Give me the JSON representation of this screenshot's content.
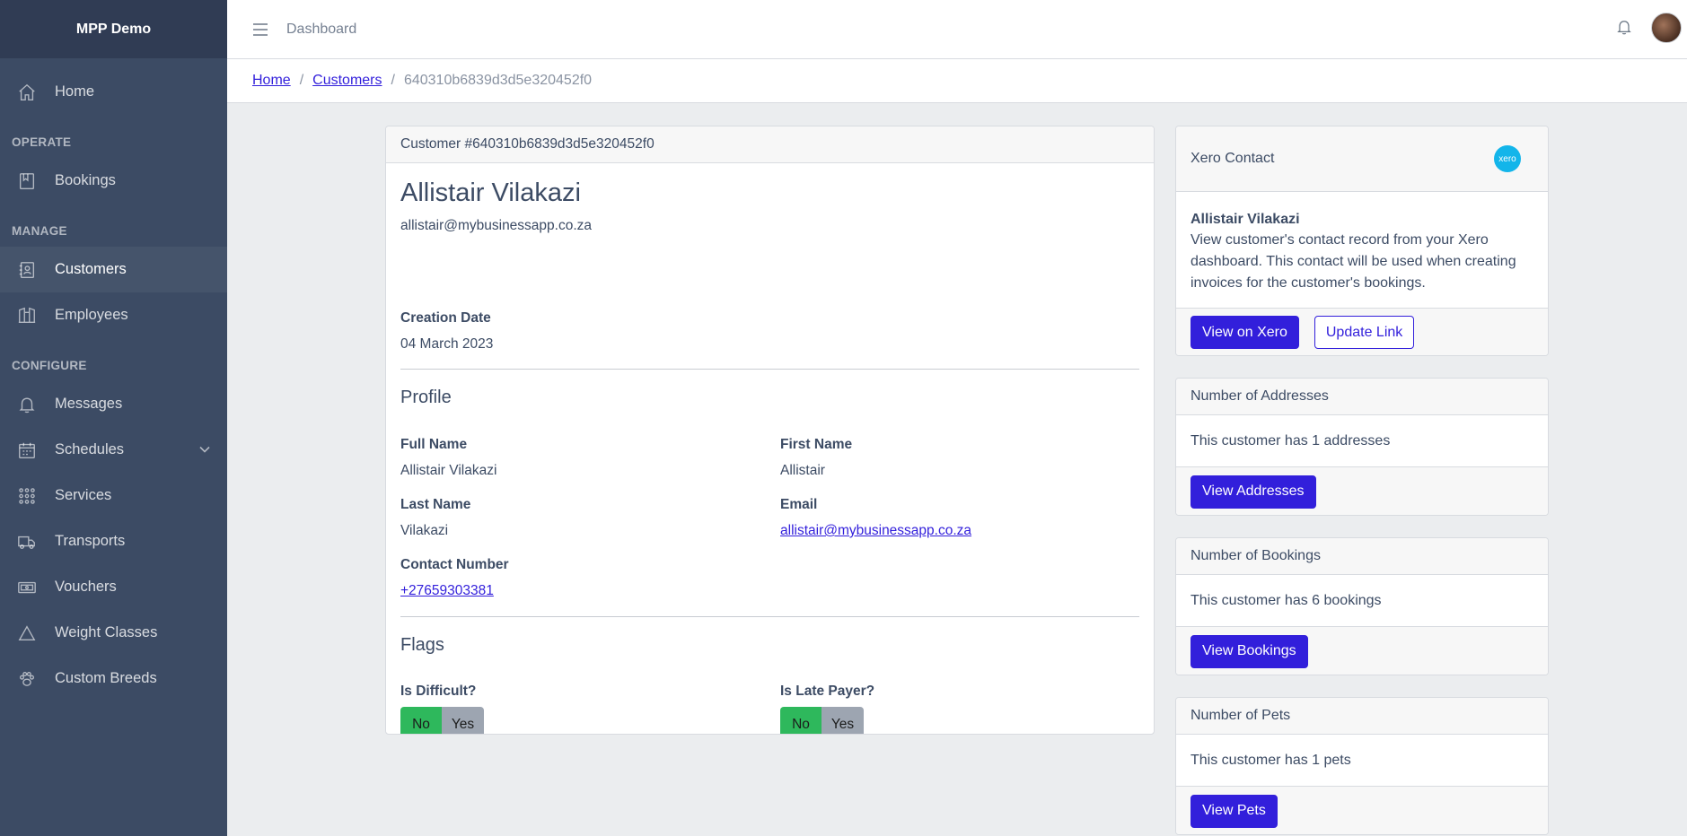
{
  "app": {
    "brand": "MPP Demo"
  },
  "sidebar": {
    "home": "Home",
    "sections": {
      "operate": "OPERATE",
      "manage": "MANAGE",
      "configure": "CONFIGURE"
    },
    "items": {
      "bookings": "Bookings",
      "customers": "Customers",
      "employees": "Employees",
      "messages": "Messages",
      "schedules": "Schedules",
      "services": "Services",
      "transports": "Transports",
      "vouchers": "Vouchers",
      "weight_classes": "Weight Classes",
      "custom_breeds": "Custom Breeds"
    },
    "active": "customers"
  },
  "header": {
    "title": "Dashboard"
  },
  "breadcrumb": {
    "home": "Home",
    "customers": "Customers",
    "current": "640310b6839d3d5e320452f0"
  },
  "customer": {
    "header": "Customer #640310b6839d3d5e320452f0",
    "name": "Allistair Vilakazi",
    "email": "allistair@mybusinessapp.co.za",
    "creation_date_label": "Creation Date",
    "creation_date": "04 March 2023",
    "profile_title": "Profile",
    "full_name_label": "Full Name",
    "full_name": "Allistair Vilakazi",
    "first_name_label": "First Name",
    "first_name": "Allistair",
    "last_name_label": "Last Name",
    "last_name": "Vilakazi",
    "email_label": "Email",
    "email_value": "allistair@mybusinessapp.co.za",
    "contact_label": "Contact Number",
    "contact": "+27659303381",
    "flags_title": "Flags",
    "difficult_label": "Is Difficult?",
    "late_payer_label": "Is Late Payer?",
    "no_label": "No",
    "yes_label": "Yes",
    "is_difficult": "No",
    "is_late_payer": "No"
  },
  "xero": {
    "title": "Xero Contact",
    "logo_text": "xero",
    "name": "Allistair Vilakazi",
    "description": "View customer's contact record from your Xero dashboard. This contact will be used when creating invoices for the customer's bookings.",
    "view_button": "View on Xero",
    "update_button": "Update Link"
  },
  "addresses": {
    "title": "Number of Addresses",
    "text": "This customer has 1 addresses",
    "button": "View Addresses"
  },
  "bookings": {
    "title": "Number of Bookings",
    "text": "This customer has 6 bookings",
    "button": "View Bookings"
  },
  "pets": {
    "title": "Number of Pets",
    "text": "This customer has 1 pets",
    "button": "View Pets"
  },
  "colors": {
    "sidebar": "#3c4b64",
    "primary": "#321fdb",
    "success": "#2eb85c",
    "secondary": "#9da5b1"
  }
}
